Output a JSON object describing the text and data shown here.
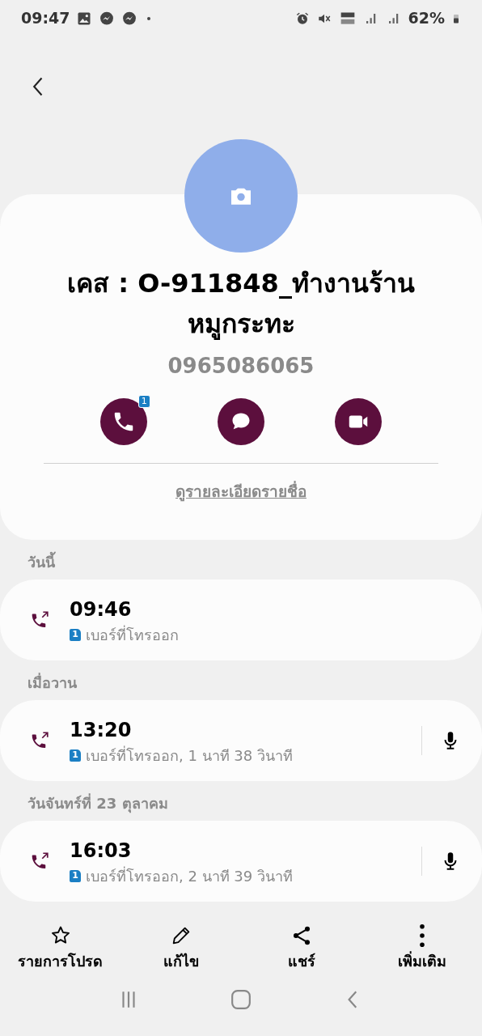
{
  "status_bar": {
    "time": "09:47",
    "battery": "62%"
  },
  "contact": {
    "name": "เคส : O-911848_ทำงานร้านหมูกระทะ",
    "phone": "0965086065"
  },
  "actions": [
    {
      "kind": "call",
      "badge": "1"
    },
    {
      "kind": "message"
    },
    {
      "kind": "video"
    }
  ],
  "details_link": "ดูรายละเอียดรายชื่อ",
  "call_groups": [
    {
      "header": "วันนี้",
      "calls": [
        {
          "time": "09:46",
          "sim": "1",
          "description": "เบอร์ที่โทรออก",
          "recording": false
        }
      ]
    },
    {
      "header": "เมื่อวาน",
      "calls": [
        {
          "time": "13:20",
          "sim": "1",
          "description": "เบอร์ที่โทรออก, 1 นาที 38 วินาที",
          "recording": true
        }
      ]
    },
    {
      "header": "วันจันทร์ที่ 23 ตุลาคม",
      "calls": [
        {
          "time": "16:03",
          "sim": "1",
          "description": "เบอร์ที่โทรออก, 2 นาที 39 วินาที",
          "recording": true
        }
      ]
    }
  ],
  "bottom_actions": [
    {
      "kind": "favorite",
      "label": "รายการโปรด"
    },
    {
      "kind": "edit",
      "label": "แก้ไข"
    },
    {
      "kind": "share",
      "label": "แชร์"
    },
    {
      "kind": "more",
      "label": "เพิ่มเติม"
    }
  ]
}
